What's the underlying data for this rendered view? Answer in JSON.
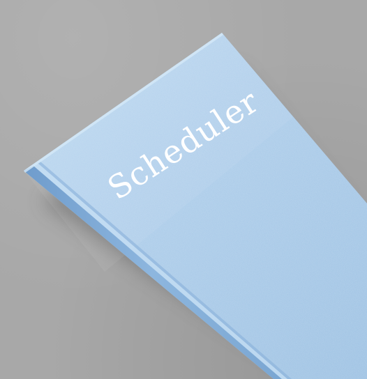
{
  "book": {
    "title": "Scheduler",
    "colors": {
      "background": "#a8a8a8",
      "cover": "#a9cbe8",
      "cover_light": "#b6d5f0",
      "cover_dark": "#8fb6da",
      "spine": "#7fa9d2",
      "page_edge": "#d9e6f1",
      "title": "#ffffff"
    }
  }
}
